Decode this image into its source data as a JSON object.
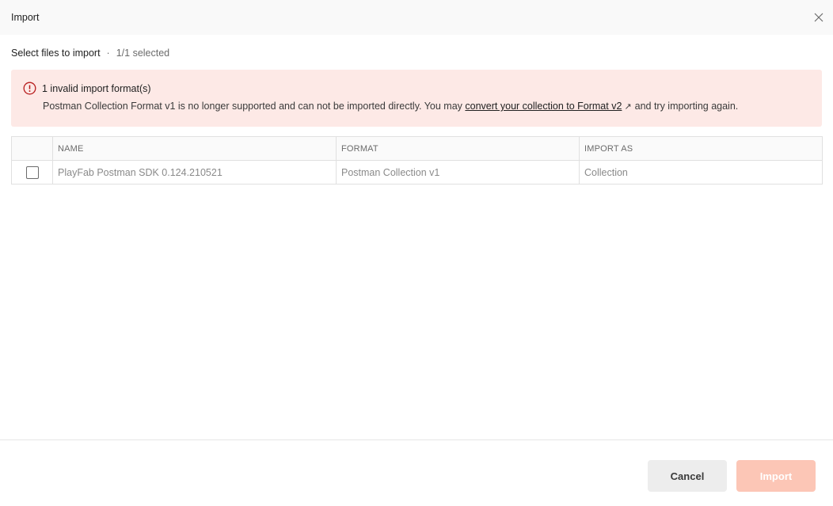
{
  "header": {
    "title": "Import",
    "close_icon": "close-icon"
  },
  "subheader": {
    "label": "Select files to import",
    "separator": "·",
    "count": "1/1 selected"
  },
  "alert": {
    "icon": "error-circle-icon",
    "title": "1 invalid import format(s)",
    "message_before": "Postman Collection Format v1 is no longer supported and can not be imported directly. You may ",
    "link_text": "convert your collection to Format v2",
    "external_icon": "↗",
    "message_after": "and try importing again.",
    "background": "#fde9e6",
    "icon_color": "#b71c1c"
  },
  "table": {
    "columns": [
      "NAME",
      "FORMAT",
      "IMPORT AS"
    ],
    "rows": [
      {
        "checked": false,
        "name": "PlayFab Postman SDK 0.124.210521",
        "format": "Postman Collection v1",
        "import_as": "Collection"
      }
    ]
  },
  "footer": {
    "cancel_label": "Cancel",
    "import_label": "Import",
    "import_color": "#fcc6b6"
  }
}
